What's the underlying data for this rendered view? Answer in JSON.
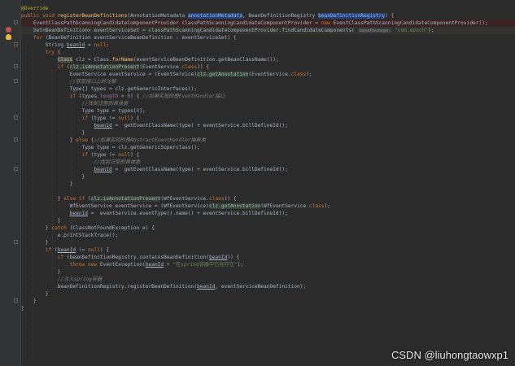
{
  "editor": {
    "lines": [
      {
        "style": "",
        "tokens": [
          {
            "t": "@Override",
            "c": "ann"
          }
        ]
      },
      {
        "style": "",
        "tokens": [
          {
            "t": "public void ",
            "c": "kw"
          },
          {
            "t": "registerBeanDefinitions",
            "c": "fn"
          },
          {
            "t": "(AnnotationMetadata "
          },
          {
            "t": "annotationMetadata",
            "c": "sel"
          },
          {
            "t": ", BeanDefinitionRegistry "
          },
          {
            "t": "beanDefinitionRegistry",
            "c": "sel"
          },
          {
            "t": ") {"
          }
        ]
      },
      {
        "style": "hl",
        "tokens": [
          {
            "t": "    EventClassPathScanningCandidateComponentProvider classPathScanningCandidateComponentProvider = "
          },
          {
            "t": "new ",
            "c": "kw"
          },
          {
            "t": "EventClassPathScanningCandidateComponentProvider();"
          }
        ]
      },
      {
        "style": "caret",
        "tokens": [
          {
            "t": "    Set<BeanDefinition> eventServiceSet = classPathScanningCandidateComponentProvider.findCandidateComponents( "
          },
          {
            "t": "basePackage:",
            "c": "hint"
          },
          {
            "t": " "
          },
          {
            "t": "\"com.epoch\"",
            "c": "str"
          },
          {
            "t": ");"
          }
        ]
      },
      {
        "style": "",
        "tokens": [
          {
            "t": "    "
          },
          {
            "t": "for ",
            "c": "kw"
          },
          {
            "t": "(BeanDefinition eventServiceBeanDefinition : eventServiceSet) {"
          }
        ]
      },
      {
        "style": "",
        "tokens": [
          {
            "t": "        String "
          },
          {
            "t": "beanId",
            "c": "ul"
          },
          {
            "t": " = "
          },
          {
            "t": "null",
            "c": "kw"
          },
          {
            "t": ";"
          }
        ]
      },
      {
        "style": "",
        "tokens": [
          {
            "t": "        "
          },
          {
            "t": "try ",
            "c": "kw"
          },
          {
            "t": "{"
          }
        ]
      },
      {
        "style": "",
        "tokens": [
          {
            "t": "            "
          },
          {
            "t": "Class",
            "c": "warn"
          },
          {
            "t": " clz = Class."
          },
          {
            "t": "forName",
            "c": "fn"
          },
          {
            "t": "(eventServiceBeanDefinition.getBeanClassName());"
          }
        ]
      },
      {
        "style": "",
        "tokens": [
          {
            "t": "            "
          },
          {
            "t": "if ",
            "c": "kw"
          },
          {
            "t": "("
          },
          {
            "t": "clz.isAnnotationPresent",
            "c": "match"
          },
          {
            "t": "(EventService."
          },
          {
            "t": "class",
            "c": "kw"
          },
          {
            "t": ")) {"
          }
        ]
      },
      {
        "style": "",
        "tokens": [
          {
            "t": "                EventService eventService = (EventService)"
          },
          {
            "t": "clz.getAnnotation",
            "c": "match"
          },
          {
            "t": "(EventService."
          },
          {
            "t": "class",
            "c": "kw"
          },
          {
            "t": ");"
          }
        ]
      },
      {
        "style": "",
        "tokens": [
          {
            "t": "                "
          },
          {
            "t": "//获取接口上的注解",
            "c": "cmt"
          }
        ]
      },
      {
        "style": "",
        "tokens": [
          {
            "t": "                Type[] types = clz.getGenericInterfaces();"
          }
        ]
      },
      {
        "style": "",
        "tokens": [
          {
            "t": "                "
          },
          {
            "t": "if ",
            "c": "kw"
          },
          {
            "t": "(types."
          },
          {
            "t": "length",
            "c": "field"
          },
          {
            "t": " > "
          },
          {
            "t": "0",
            "c": "num"
          },
          {
            "t": ") { "
          },
          {
            "t": "//如果实现的是EventHandler接口",
            "c": "cmt"
          }
        ]
      },
      {
        "style": "",
        "tokens": [
          {
            "t": "                    "
          },
          {
            "t": "//找到泛型的具体类",
            "c": "cmt"
          }
        ]
      },
      {
        "style": "",
        "tokens": [
          {
            "t": "                    Type type = types["
          },
          {
            "t": "0",
            "c": "num"
          },
          {
            "t": "];"
          }
        ]
      },
      {
        "style": "",
        "tokens": [
          {
            "t": "                    "
          },
          {
            "t": "if ",
            "c": "kw"
          },
          {
            "t": "(type != "
          },
          {
            "t": "null",
            "c": "kw"
          },
          {
            "t": ") {"
          }
        ]
      },
      {
        "style": "",
        "tokens": [
          {
            "t": "                        "
          },
          {
            "t": "beanId",
            "c": "ul"
          },
          {
            "t": " =  getEventClassName(type) + eventService.billDefineId();"
          }
        ]
      },
      {
        "style": "",
        "tokens": [
          {
            "t": "                    }"
          }
        ]
      },
      {
        "style": "",
        "tokens": [
          {
            "t": "                } "
          },
          {
            "t": "else ",
            "c": "kw"
          },
          {
            "t": "{"
          },
          {
            "t": "//如果实现的是AbstractEventHandler抽象类",
            "c": "cmt"
          }
        ]
      },
      {
        "style": "",
        "tokens": [
          {
            "t": "                    Type type = clz.getGenericSuperclass();"
          }
        ]
      },
      {
        "style": "",
        "tokens": [
          {
            "t": "                    "
          },
          {
            "t": "if ",
            "c": "kw"
          },
          {
            "t": "(type != "
          },
          {
            "t": "null",
            "c": "kw"
          },
          {
            "t": ") {"
          }
        ]
      },
      {
        "style": "",
        "tokens": [
          {
            "t": "                        "
          },
          {
            "t": "//找到泛型的具体类",
            "c": "cmt"
          }
        ]
      },
      {
        "style": "",
        "tokens": [
          {
            "t": "                        "
          },
          {
            "t": "beanId",
            "c": "ul"
          },
          {
            "t": " =  getEventClassName(type) + eventService.billDefineId();"
          }
        ]
      },
      {
        "style": "",
        "tokens": [
          {
            "t": "                    }"
          }
        ]
      },
      {
        "style": "",
        "tokens": [
          {
            "t": "                }"
          }
        ]
      },
      {
        "style": "",
        "tokens": [
          {
            "t": ""
          }
        ]
      },
      {
        "style": "",
        "tokens": [
          {
            "t": "            } "
          },
          {
            "t": "else if ",
            "c": "kw"
          },
          {
            "t": "("
          },
          {
            "t": "clz.isAnnotationPresent",
            "c": "match"
          },
          {
            "t": "(WfEventService."
          },
          {
            "t": "class",
            "c": "kw"
          },
          {
            "t": ")) {"
          }
        ]
      },
      {
        "style": "",
        "tokens": [
          {
            "t": "                WfEventService eventService = (WfEventService)"
          },
          {
            "t": "clz.getAnnotation",
            "c": "match"
          },
          {
            "t": "(WfEventService."
          },
          {
            "t": "class",
            "c": "kw"
          },
          {
            "t": ");"
          }
        ]
      },
      {
        "style": "",
        "tokens": [
          {
            "t": "                "
          },
          {
            "t": "beanId",
            "c": "ul"
          },
          {
            "t": " =  eventService.eventType().name() + eventService.billDefineId();"
          }
        ]
      },
      {
        "style": "",
        "tokens": [
          {
            "t": "            }"
          }
        ]
      },
      {
        "style": "",
        "tokens": [
          {
            "t": "        } "
          },
          {
            "t": "catch ",
            "c": "kw"
          },
          {
            "t": "(ClassNotFoundException e) {"
          }
        ]
      },
      {
        "style": "",
        "tokens": [
          {
            "t": "            e.printStackTrace();"
          }
        ]
      },
      {
        "style": "",
        "tokens": [
          {
            "t": "        }"
          }
        ]
      },
      {
        "style": "",
        "tokens": [
          {
            "t": "        "
          },
          {
            "t": "if ",
            "c": "kw"
          },
          {
            "t": "("
          },
          {
            "t": "beanId",
            "c": "ul"
          },
          {
            "t": " != "
          },
          {
            "t": "null",
            "c": "kw"
          },
          {
            "t": ") {"
          }
        ]
      },
      {
        "style": "",
        "tokens": [
          {
            "t": "            "
          },
          {
            "t": "if ",
            "c": "kw"
          },
          {
            "t": "(beanDefinitionRegistry.containsBeanDefinition("
          },
          {
            "t": "beanId",
            "c": "ul"
          },
          {
            "t": ")) {"
          }
        ]
      },
      {
        "style": "",
        "tokens": [
          {
            "t": "                "
          },
          {
            "t": "throw new ",
            "c": "kw"
          },
          {
            "t": "EventException("
          },
          {
            "t": "beanId",
            "c": "ul"
          },
          {
            "t": " + "
          },
          {
            "t": "\"在spring容器中已经存在\"",
            "c": "str"
          },
          {
            "t": ");"
          }
        ]
      },
      {
        "style": "",
        "tokens": [
          {
            "t": "            }"
          }
        ]
      },
      {
        "style": "",
        "tokens": [
          {
            "t": "            "
          },
          {
            "t": "//注入spring容器",
            "c": "cmt"
          }
        ]
      },
      {
        "style": "",
        "tokens": [
          {
            "t": "            beanDefinitionRegistry.registerBeanDefinition("
          },
          {
            "t": "beanId",
            "c": "ul"
          },
          {
            "t": ", eventServiceBeanDefinition);"
          }
        ]
      },
      {
        "style": "",
        "tokens": [
          {
            "t": "        }"
          }
        ]
      },
      {
        "style": "",
        "tokens": [
          {
            "t": "    }"
          }
        ]
      },
      {
        "style": "",
        "tokens": [
          {
            "t": "}"
          }
        ]
      }
    ]
  },
  "watermark": "CSDN @liuhongtaowxp1",
  "colors": {
    "background": "#2b2b2b",
    "keyword": "#cc7832",
    "annotation": "#bbb529",
    "method": "#ffc66d",
    "string": "#6a8759",
    "comment": "#808080",
    "number": "#6897bb",
    "error_line": "#3a2323",
    "selection": "#214283"
  },
  "icons": [
    "breakpoint-icon",
    "intention-bulb-icon",
    "fold-marker-icon"
  ]
}
